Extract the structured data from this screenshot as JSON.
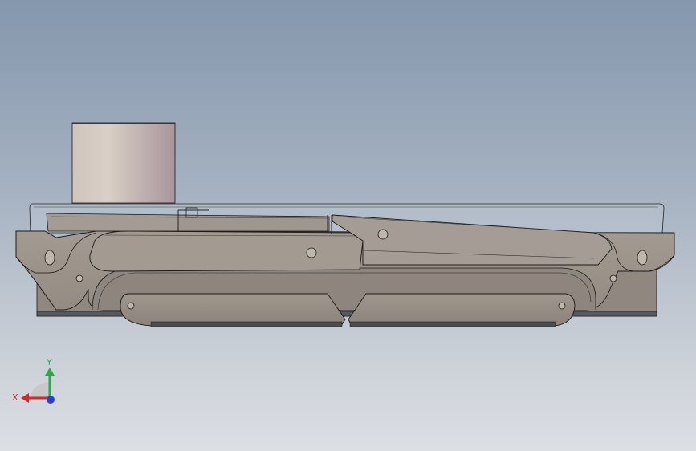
{
  "viewport": {
    "background_top": "#8597ad",
    "background_bottom": "#dcdfe4"
  },
  "model": {
    "body_color": "#9e958d",
    "body_shadow_color": "#7f7872",
    "cylinder_color_light": "#d9cfc6",
    "cylinder_color_dark": "#b29fa4",
    "outline_color": "#1a1a1a",
    "transparent_cover_color": "#c9d2de"
  },
  "triad": {
    "x_label": "X",
    "y_label": "Y",
    "x_color": "#d42a2a",
    "y_color": "#2fa84a",
    "z_color": "#2a3fd4",
    "icon": "coordinate-triad-icon"
  }
}
